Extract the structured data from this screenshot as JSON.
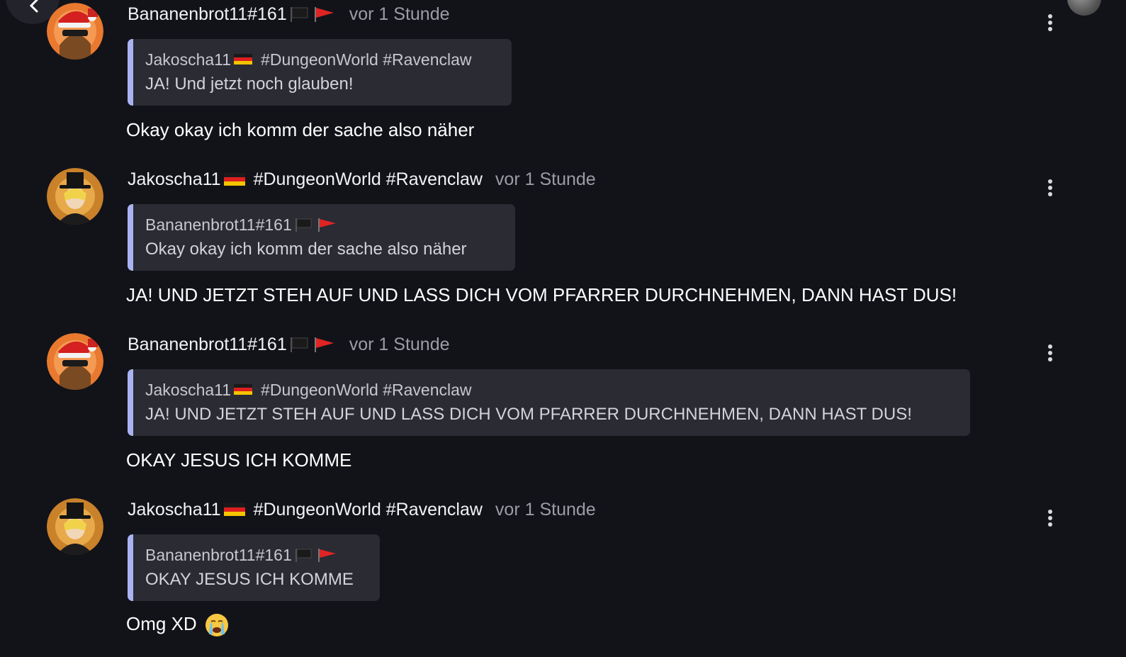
{
  "app": {
    "accent_color": "#a9b3f2",
    "background_color": "#121319",
    "back_icon": "chevron-left-icon",
    "menu_icon": "more-vertical-icon"
  },
  "messages": [
    {
      "author": "Bananenbrot11#161",
      "author_flags": [
        "black-flag",
        "red-flag"
      ],
      "time": "vor 1 Stunde",
      "quote": {
        "author": "Jakoscha11",
        "author_flag": "german-flag",
        "author_tags": "#DungeonWorld #Ravenclaw",
        "text": "JA! Und jetzt noch glauben!"
      },
      "text": "Okay okay ich komm der sache also näher"
    },
    {
      "author": "Jakoscha11",
      "author_flag": "german-flag",
      "author_tags": "#DungeonWorld #Ravenclaw",
      "time": "vor 1 Stunde",
      "quote": {
        "author": "Bananenbrot11#161",
        "author_flags": [
          "black-flag",
          "red-flag"
        ],
        "text": "Okay okay ich komm der sache also näher"
      },
      "text": "JA! UND JETZT STEH AUF UND LASS DICH VOM PFARRER DURCHNEHMEN, DANN HAST DUS!"
    },
    {
      "author": "Bananenbrot11#161",
      "author_flags": [
        "black-flag",
        "red-flag"
      ],
      "time": "vor 1 Stunde",
      "quote": {
        "author": "Jakoscha11",
        "author_flag": "german-flag",
        "author_tags": "#DungeonWorld #Ravenclaw",
        "text": "JA! UND JETZT STEH AUF UND LASS DICH VOM PFARRER DURCHNEHMEN, DANN HAST DUS!"
      },
      "text": "OKAY JESUS ICH KOMME"
    },
    {
      "author": "Jakoscha11",
      "author_flag": "german-flag",
      "author_tags": "#DungeonWorld #Ravenclaw",
      "time": "vor 1 Stunde",
      "quote": {
        "author": "Bananenbrot11#161",
        "author_flags": [
          "black-flag",
          "red-flag"
        ],
        "text": "OKAY JESUS ICH KOMME"
      },
      "text": "Omg XD",
      "text_emoji": "crying-face-emoji"
    }
  ]
}
